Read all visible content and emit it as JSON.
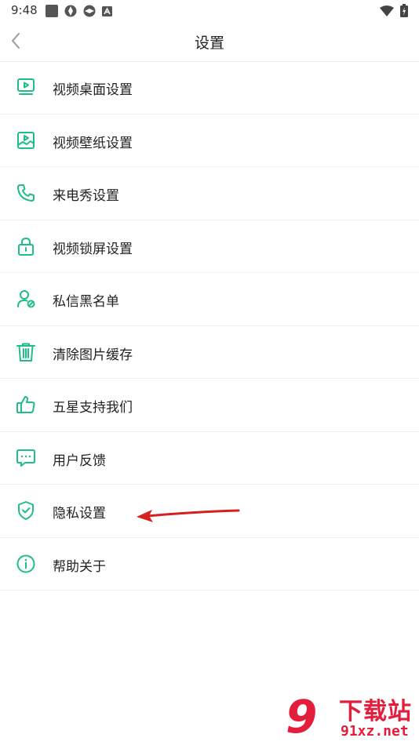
{
  "status_bar": {
    "time": "9:48"
  },
  "header": {
    "title": "设置"
  },
  "menu": [
    {
      "label": "视频桌面设置",
      "icon": "video-desktop-icon"
    },
    {
      "label": "视频壁纸设置",
      "icon": "wallpaper-icon"
    },
    {
      "label": "来电秀设置",
      "icon": "phone-icon"
    },
    {
      "label": "视频锁屏设置",
      "icon": "lock-icon"
    },
    {
      "label": "私信黑名单",
      "icon": "user-block-icon"
    },
    {
      "label": "清除图片缓存",
      "icon": "trash-icon"
    },
    {
      "label": "五星支持我们",
      "icon": "thumbs-up-icon"
    },
    {
      "label": "用户反馈",
      "icon": "chat-icon"
    },
    {
      "label": "隐私设置",
      "icon": "shield-icon"
    },
    {
      "label": "帮助关于",
      "icon": "info-icon"
    }
  ],
  "watermark": {
    "logo": "9",
    "top": "下载站",
    "bottom": "91xz.net"
  },
  "colors": {
    "accent": "#1fbe88",
    "annotation": "#d61f1f",
    "watermark": "#e31d3b"
  }
}
